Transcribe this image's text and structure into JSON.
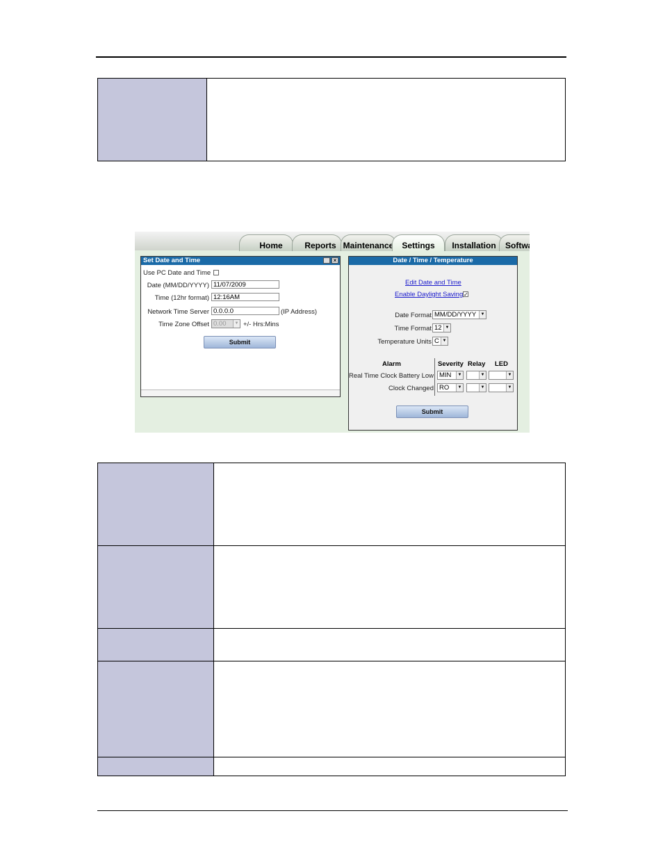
{
  "screenshot": {
    "tabs": [
      "Home",
      "Reports",
      "Maintenance",
      "Settings",
      "Installation",
      "Softwa"
    ],
    "active_tab": "Settings",
    "left_window": {
      "title": "Set Date and Time",
      "use_pc_label": "Use PC Date and Time",
      "date_label": "Date (MM/DD/YYYY)",
      "date_value": "11/07/2009",
      "time_label": "Time (12hr format)",
      "time_value": "12:16AM",
      "nts_label": "Network Time Server",
      "nts_value": "0.0.0.0",
      "nts_suffix": "(IP Address)",
      "tz_label": "Time Zone Offset",
      "tz_value": "0.00",
      "tz_suffix": "+/- Hrs:Mins",
      "submit_label": "Submit"
    },
    "right_window": {
      "title": "Date / Time / Temperature",
      "edit_link": "Edit Date and Time",
      "dst_link": "Enable Daylight Saving",
      "dst_checked": "✓",
      "date_format_label": "Date Format",
      "date_format_value": "MM/DD/YYYY",
      "time_format_label": "Time Format",
      "time_format_value": "12",
      "temp_units_label": "Temperature Units",
      "temp_units_value": "C",
      "col_alarm": "Alarm",
      "col_severity": "Severity",
      "col_relay": "Relay",
      "col_led": "LED",
      "alarm_rows": [
        {
          "name": "Real Time Clock Battery Low",
          "severity": "MIN"
        },
        {
          "name": "Clock Changed",
          "severity": "RO"
        }
      ],
      "submit_label": "Submit"
    }
  },
  "colors": {
    "table_key_bg": "#c5c6dc",
    "window_title_bg": "#1a6aa7",
    "panel_bg": "#e4efe1"
  }
}
